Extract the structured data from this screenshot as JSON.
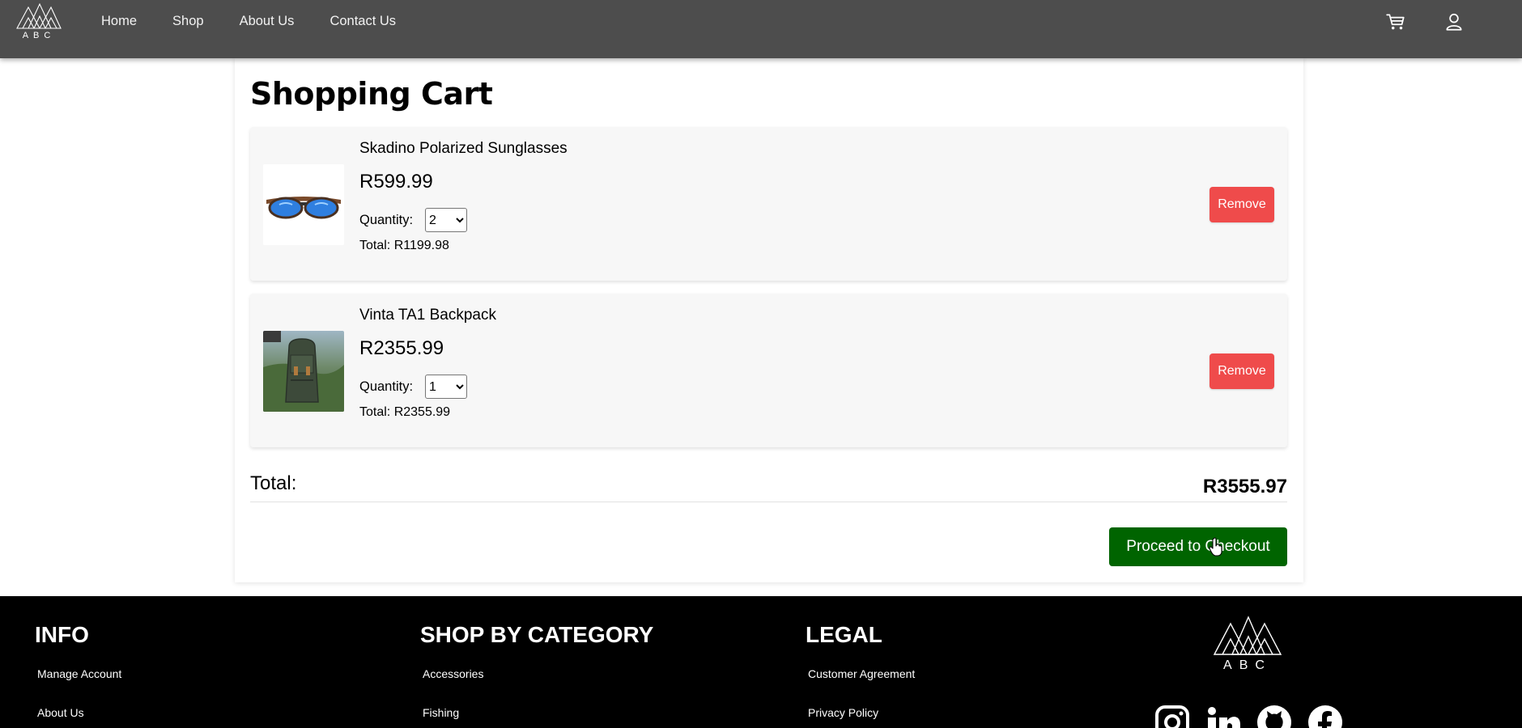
{
  "navbar": {
    "logo_text": "ABC",
    "links": [
      "Home",
      "Shop",
      "About Us",
      "Contact Us"
    ]
  },
  "cart": {
    "title": "Shopping Cart",
    "quantity_label": "Quantity:",
    "items": [
      {
        "name": "Skadino Polarized Sunglasses",
        "price": "R599.99",
        "quantity": "2",
        "total": "Total: R1199.98",
        "remove_label": "Remove"
      },
      {
        "name": "Vinta TA1 Backpack",
        "price": "R2355.99",
        "quantity": "1",
        "total": "Total: R2355.99",
        "remove_label": "Remove"
      }
    ],
    "total_label": "Total:",
    "total_value": "R3555.97",
    "checkout_label": "Proceed to Checkout"
  },
  "footer": {
    "info": {
      "heading": "INFO",
      "links": [
        "Manage Account",
        "About Us"
      ]
    },
    "category": {
      "heading": "SHOP BY CATEGORY",
      "links": [
        "Accessories",
        "Fishing"
      ]
    },
    "legal": {
      "heading": "LEGAL",
      "links": [
        "Customer Agreement",
        "Privacy Policy"
      ]
    },
    "logo_text": "ABC",
    "social_icons": [
      "instagram-icon",
      "linkedin-icon",
      "github-icon",
      "facebook-icon"
    ]
  },
  "colors": {
    "navbar": "#4d4d4d",
    "remove": "#ef4b4b",
    "checkout": "#006400",
    "footer": "#000000"
  }
}
